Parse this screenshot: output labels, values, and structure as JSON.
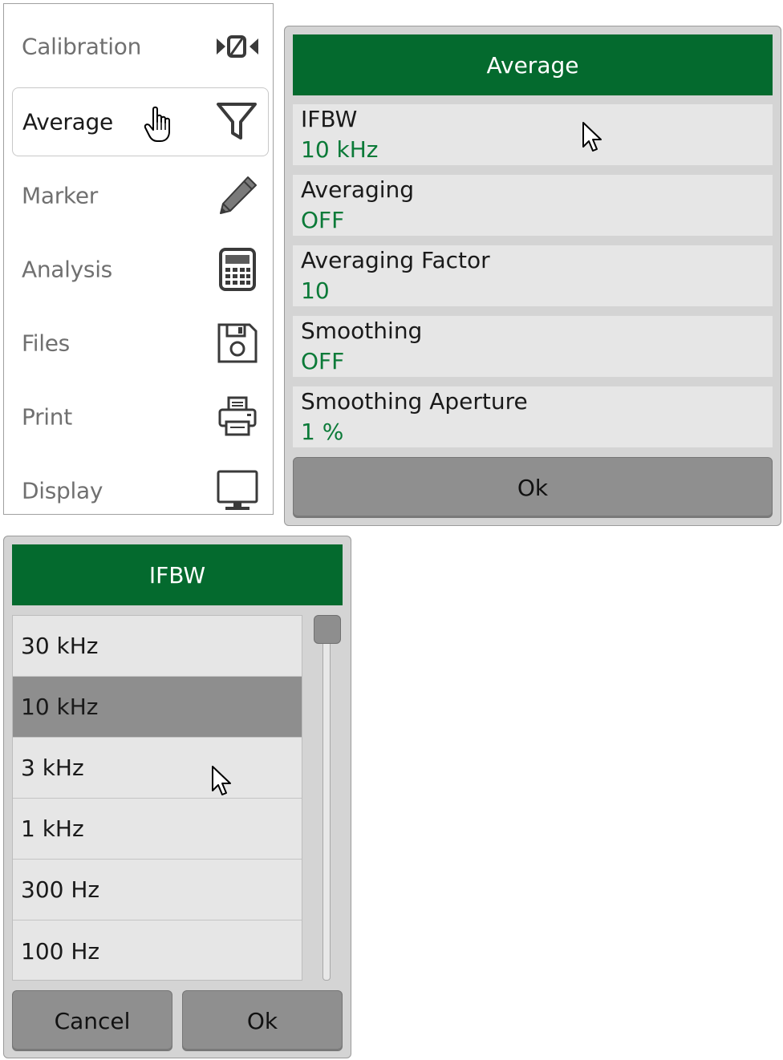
{
  "menu": {
    "items": [
      {
        "label": "Calibration",
        "icon": "calibration-icon"
      },
      {
        "label": "Average",
        "icon": "filter-funnel-icon",
        "selected": true
      },
      {
        "label": "Marker",
        "icon": "pencil-icon"
      },
      {
        "label": "Analysis",
        "icon": "calculator-icon"
      },
      {
        "label": "Files",
        "icon": "floppy-disk-icon"
      },
      {
        "label": "Print",
        "icon": "printer-icon"
      },
      {
        "label": "Display",
        "icon": "monitor-icon"
      }
    ]
  },
  "average_dialog": {
    "title": "Average",
    "params": [
      {
        "label": "IFBW",
        "value": "10 kHz"
      },
      {
        "label": "Averaging",
        "value": "OFF"
      },
      {
        "label": "Averaging Factor",
        "value": "10"
      },
      {
        "label": "Smoothing",
        "value": "OFF"
      },
      {
        "label": "Smoothing Aperture",
        "value": "1 %"
      }
    ],
    "ok_label": "Ok"
  },
  "ifbw_dialog": {
    "title": "IFBW",
    "options": [
      "30 kHz",
      "10 kHz",
      "3 kHz",
      "1 kHz",
      "300 Hz",
      "100 Hz"
    ],
    "selected": "10 kHz",
    "cancel_label": "Cancel",
    "ok_label": "Ok"
  },
  "colors": {
    "title_bar": "#046a2e",
    "value_text": "#0b7a38",
    "button": "#8f8f8f",
    "selected_row": "#8e8e8e",
    "dialog_bg": "#d4d4d4",
    "row_bg": "#e6e6e6"
  }
}
